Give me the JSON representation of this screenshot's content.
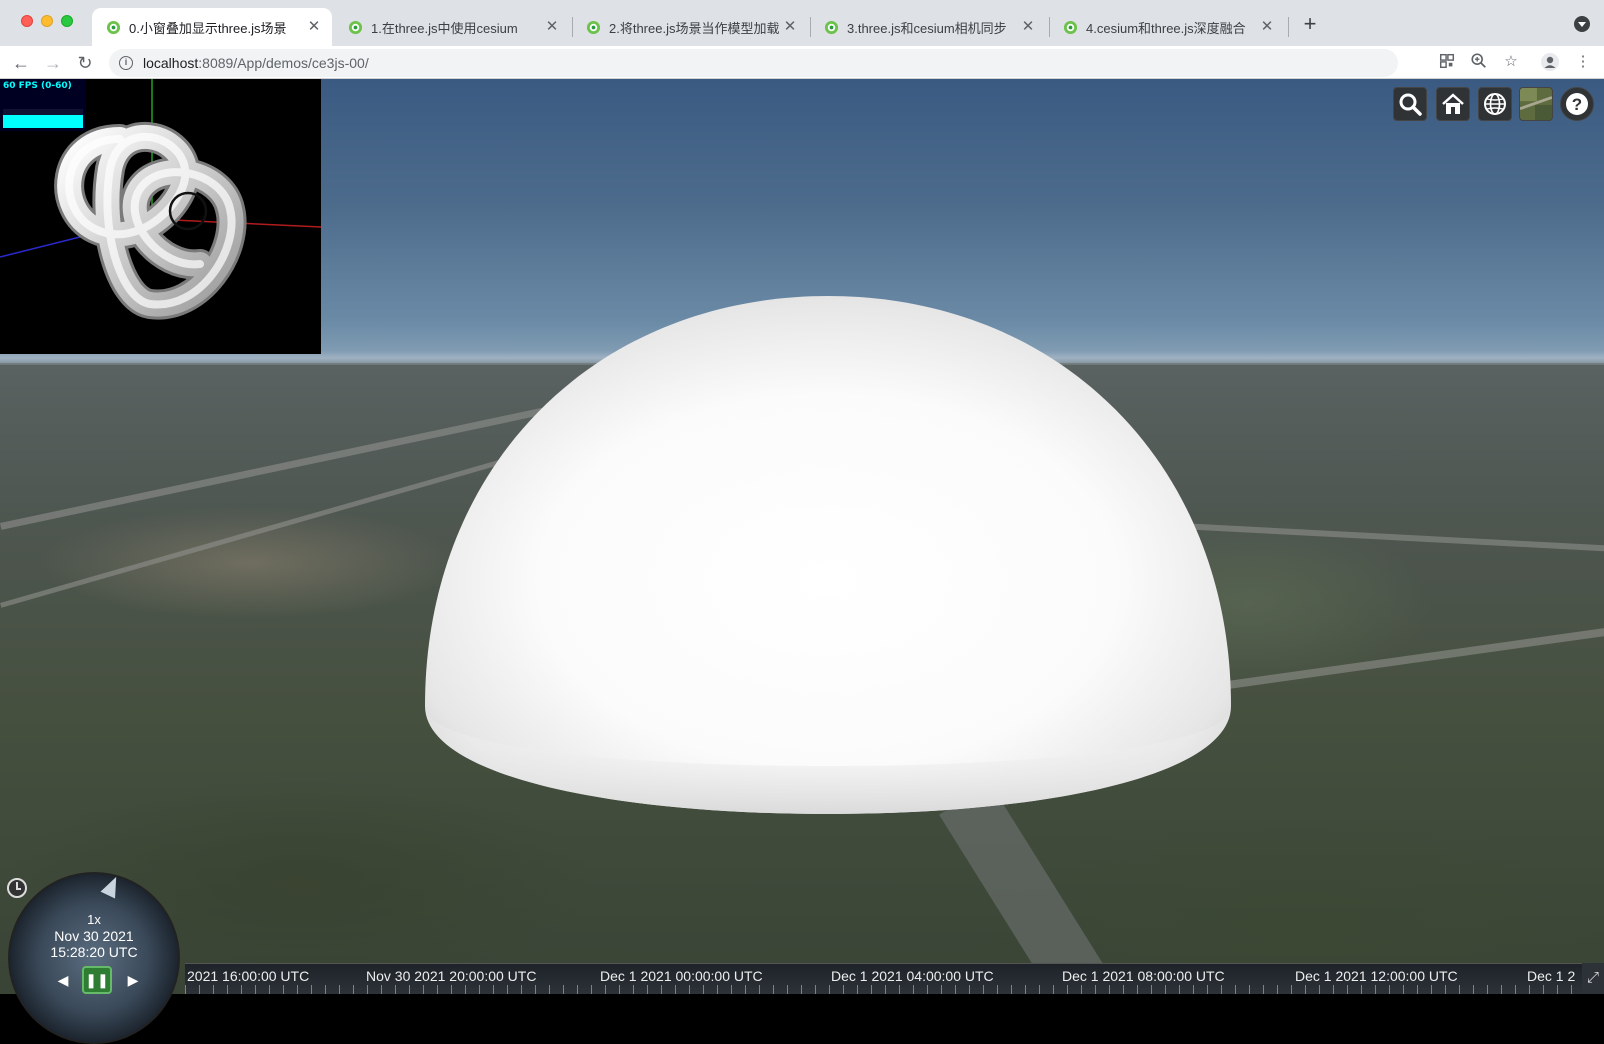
{
  "browser": {
    "tabs": [
      {
        "label": "0.小窗叠加显示three.js场景",
        "active": true
      },
      {
        "label": "1.在three.js中使用cesium",
        "active": false
      },
      {
        "label": "2.将three.js场景当作模型加载",
        "active": false
      },
      {
        "label": "3.three.js和cesium相机同步",
        "active": false
      },
      {
        "label": "4.cesium和three.js深度融合",
        "active": false
      }
    ],
    "url_host": "localhost",
    "url_path": ":8089/App/demos/ce3js-00/"
  },
  "stats": {
    "fps_label": "60 FPS (0-60)"
  },
  "cesium_toolbar": [
    "search-icon",
    "home-icon",
    "globe-icon",
    "imagery-layer-icon",
    "help-icon"
  ],
  "animation": {
    "speed": "1x",
    "date": "Nov 30 2021",
    "time": "15:28:20 UTC"
  },
  "timeline": {
    "labels": [
      "2021 16:00:00 UTC",
      "Nov 30 2021 20:00:00 UTC",
      "Dec 1 2021 00:00:00 UTC",
      "Dec 1 2021 04:00:00 UTC",
      "Dec 1 2021 08:00:00 UTC",
      "Dec 1 2021 12:00:00 UTC",
      "Dec 1 2"
    ]
  },
  "colors": {
    "tab_bar": "#dee1e6",
    "fps_text": "#00ffff"
  }
}
